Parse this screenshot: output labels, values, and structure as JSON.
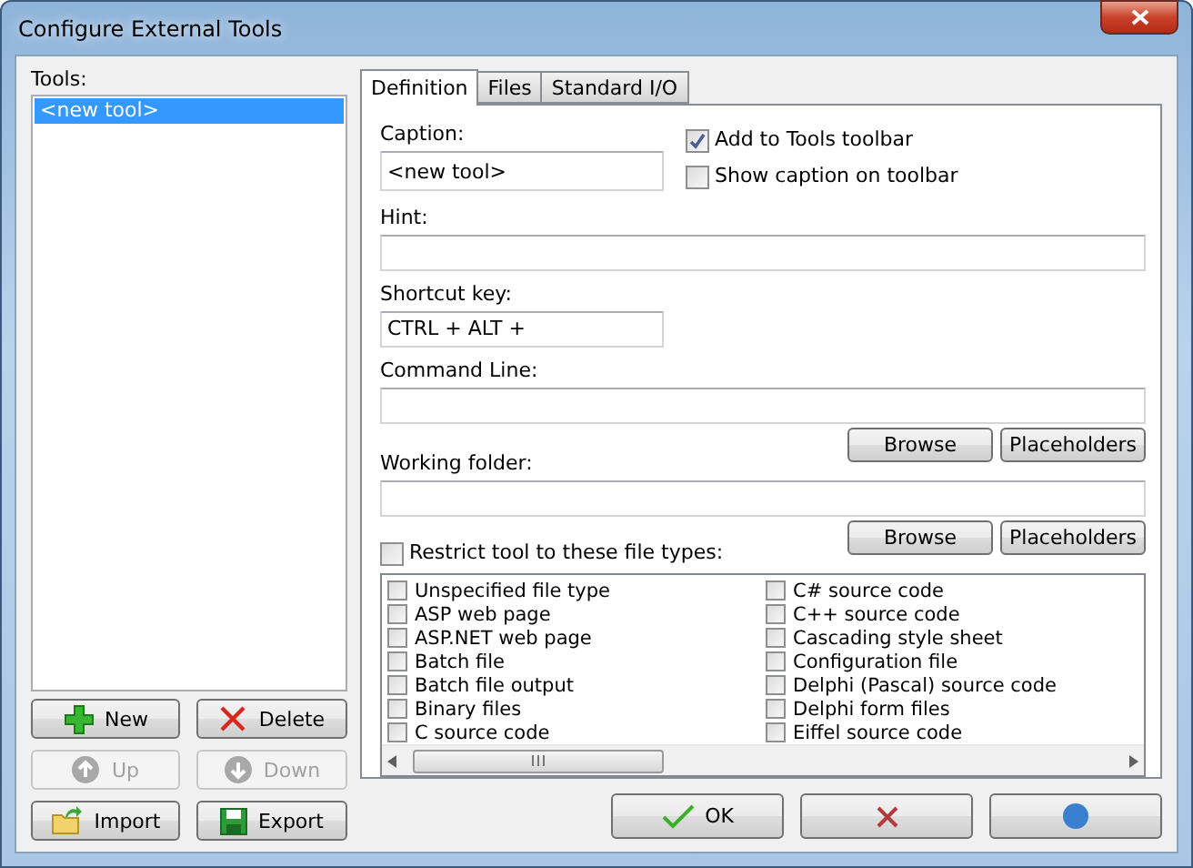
{
  "window": {
    "title": "Configure External Tools"
  },
  "tools": {
    "label": "Tools:",
    "items": [
      {
        "label": "<new tool>",
        "selected": true
      }
    ]
  },
  "tool_buttons": [
    {
      "label": "New",
      "disabled": false
    },
    {
      "label": "Delete",
      "disabled": false
    },
    {
      "label": "Up",
      "disabled": true
    },
    {
      "label": "Down",
      "disabled": true
    },
    {
      "label": "Import",
      "disabled": false
    },
    {
      "label": "Export",
      "disabled": false
    }
  ],
  "tabs": [
    {
      "label": "Definition",
      "selected": true
    },
    {
      "label": "Files",
      "selected": false
    },
    {
      "label": "Standard I/O",
      "selected": false
    }
  ],
  "caption": {
    "label": "Caption:",
    "value": "<new tool>"
  },
  "add_to_toolbar": {
    "label": "Add to Tools toolbar",
    "checked": true
  },
  "show_caption": {
    "label": "Show caption on toolbar",
    "checked": false
  },
  "hint": {
    "label": "Hint:"
  },
  "shortcut": {
    "label": "Shortcut key:",
    "value": "CTRL + ALT +"
  },
  "command_line": {
    "label": "Command Line:",
    "buttons": [
      "Browse",
      "Placeholders"
    ]
  },
  "working_folder": {
    "label": "Working folder:",
    "buttons": [
      "Browse",
      "Placeholders"
    ]
  },
  "restrict": {
    "label": "Restrict tool to these file types:",
    "checked": false
  },
  "file_types": [
    {
      "label": "Unspecified file type",
      "checked": false
    },
    {
      "label": "ASP web page",
      "checked": false
    },
    {
      "label": "ASP.NET web page",
      "checked": false
    },
    {
      "label": "Batch file",
      "checked": false
    },
    {
      "label": "Batch file output",
      "checked": false
    },
    {
      "label": "Binary files",
      "checked": false
    },
    {
      "label": "C source code",
      "checked": false
    },
    {
      "label": "C# source code",
      "checked": false
    },
    {
      "label": "C++ source code",
      "checked": false
    },
    {
      "label": "Cascading style sheet",
      "checked": false
    },
    {
      "label": "Configuration file",
      "checked": false
    },
    {
      "label": "Delphi (Pascal) source code",
      "checked": false
    },
    {
      "label": "Delphi form files",
      "checked": false
    },
    {
      "label": "Eiffel source code",
      "checked": false
    }
  ],
  "footer_buttons": [
    {
      "label": "OK"
    }
  ]
}
